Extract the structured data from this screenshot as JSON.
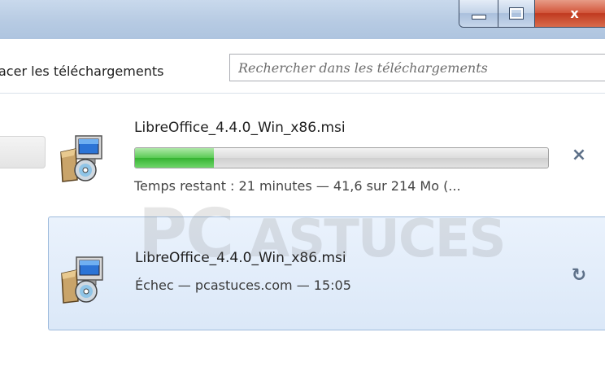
{
  "window": {
    "minimize_icon": "minimize-icon",
    "maximize_icon": "maximize-icon",
    "close_glyph": "x",
    "close_color": "#c0391f"
  },
  "toolbar": {
    "clear_label": "acer les téléchargements",
    "search_placeholder": "Rechercher dans les téléchargements"
  },
  "downloads": [
    {
      "filename": "LibreOffice_4.4.0_Win_x86.msi",
      "progress_fraction": 0.19,
      "status": "Temps restant : 21 minutes — 41,6 sur 214 Mo (...",
      "action_glyph": "×",
      "action_icon": "cancel-icon",
      "file_icon": "msi-installer-icon"
    },
    {
      "filename": "LibreOffice_4.4.0_Win_x86.msi",
      "status": "Échec — pcastuces.com — 15:05",
      "action_glyph": "↻",
      "action_icon": "retry-icon",
      "file_icon": "msi-installer-icon",
      "selected": true
    }
  ],
  "watermark": {
    "text_big": "PC",
    "text_small": "ASTUCES"
  },
  "colors": {
    "progress_fill": "#36b332",
    "selected_row": "#dbe8f8",
    "selected_border": "#9ebbdd"
  }
}
